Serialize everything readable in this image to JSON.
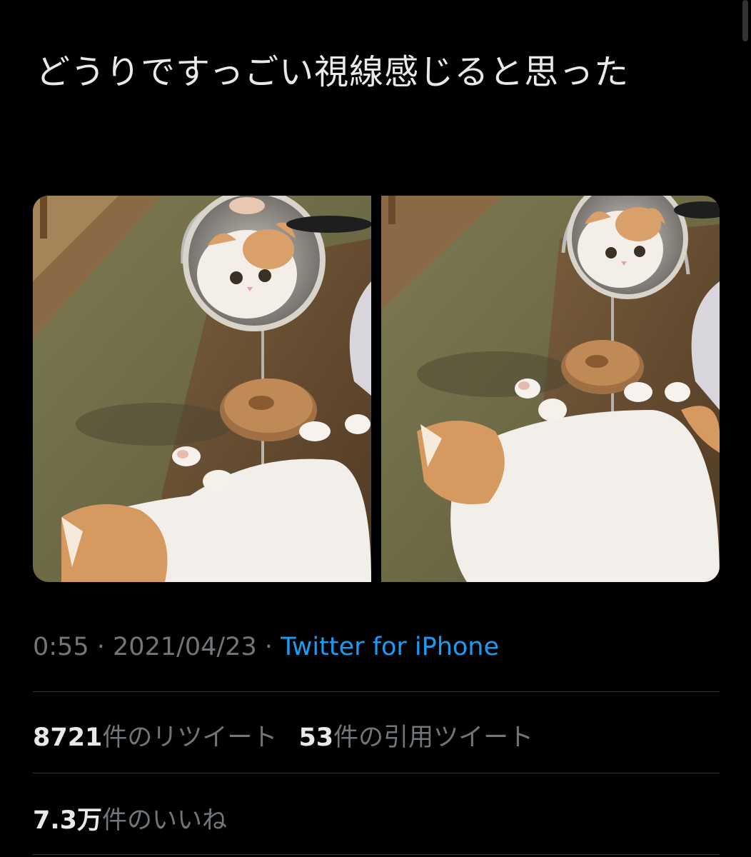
{
  "tweet": {
    "text": "どうりですっごい視線感じると思った",
    "time": "0:55",
    "separator": "·",
    "date": "2021/04/23",
    "source": "Twitter for iPhone"
  },
  "media": {
    "photos": [
      {
        "subject": "cat reflected in tabletop mirror, cat lying on tatami"
      },
      {
        "subject": "cat reflected in tabletop mirror, cat lying on tatami"
      }
    ]
  },
  "stats": {
    "retweets_count": "8721",
    "retweets_label": "件のリツイート",
    "quotes_count": "53",
    "quotes_label": "件の引用ツイート",
    "likes_count": "7.3万",
    "likes_label": "件のいいね"
  },
  "colors": {
    "background": "#000000",
    "text": "#e7e9ea",
    "muted": "#71767b",
    "link": "#1d9bf0",
    "divider": "#2f3336"
  }
}
